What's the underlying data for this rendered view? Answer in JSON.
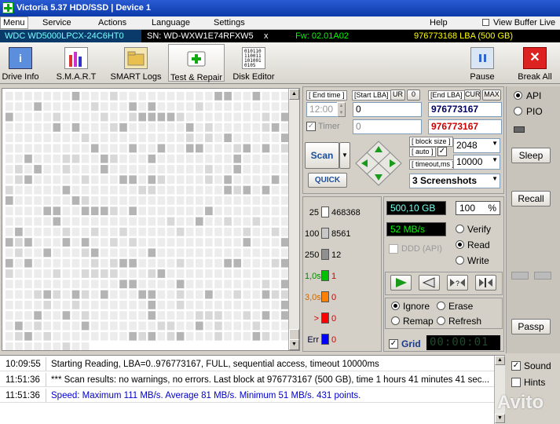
{
  "window": {
    "title": "Victoria 5.37 HDD/SSD | Device 1"
  },
  "menu": {
    "items": [
      "Menu",
      "Service",
      "Actions",
      "Language",
      "Settings",
      "Help"
    ],
    "view_buffer": "View Buffer Live"
  },
  "device": {
    "model": "WDC WD5000LPCX-24C6HT0",
    "serial": "SN: WD-WXW1E74RFXW5",
    "close": "x",
    "firmware": "Fw: 02.01A02",
    "lba": "976773168 LBA (500 GB)"
  },
  "toolbar": {
    "drive_info": "Drive Info",
    "smart": "S.M.A.R.T",
    "smart_logs": "SMART Logs",
    "test_repair": "Test & Repair",
    "disk_editor": "Disk Editor",
    "pause": "Pause",
    "break_all": "Break All"
  },
  "scan": {
    "end_time_lbl": "[ End time ]",
    "start_lba_lbl": "[Start LBA]",
    "ur": "UR",
    "zero": "0",
    "end_lba_lbl": "[End LBA]",
    "cur": "CUR",
    "max": "MAX",
    "time_value": "12:00",
    "start_lba": "0",
    "end_lba": "976773167",
    "timer_label": "Timer",
    "timer_value": "0",
    "end_lba2": "976773167",
    "block_size_lbl": "[ block size ]",
    "auto_lbl": "[ auto ]",
    "block_size": "2048",
    "timeout_lbl": "[ timeout,ms ]",
    "timeout": "10000",
    "scan_btn": "Scan",
    "quick_btn": "QUICK",
    "screenshots": "3 Screenshots"
  },
  "legend": [
    {
      "label": "25",
      "count": "468368",
      "color": "#ffffff"
    },
    {
      "label": "100",
      "count": "8561",
      "color": "#c8c8c8"
    },
    {
      "label": "250",
      "count": "12",
      "color": "#909090"
    },
    {
      "label": "1,0s",
      "count": "1",
      "color": "#00c000"
    },
    {
      "label": "3,0s",
      "count": "0",
      "color": "#ff8000"
    },
    {
      "label": ">",
      "count": "0",
      "color": "#ff0000"
    },
    {
      "label": "Err",
      "count": "0",
      "color": "#0000ff"
    }
  ],
  "stats": {
    "size": "500,10 GB",
    "percent": "100",
    "pct_sign": "%",
    "speed": "52 MB/s"
  },
  "mode": {
    "verify": "Verify",
    "read": "Read",
    "write": "Write",
    "ddd": "DDD (API)",
    "ignore": "Ignore",
    "erase": "Erase",
    "remap": "Remap",
    "refresh": "Refresh",
    "grid": "Grid",
    "timer": "00:00:01"
  },
  "side": {
    "api": "API",
    "pio": "PIO",
    "sleep": "Sleep",
    "recall": "Recall",
    "passp": "Passp"
  },
  "log": [
    {
      "time": "10:09:55",
      "msg": "Starting Reading, LBA=0..976773167, FULL, sequential access, timeout 10000ms",
      "color": "#000000"
    },
    {
      "time": "11:51:36",
      "msg": "*** Scan results: no warnings, no errors. Last block at 976773167 (500 GB), time 1 hours 41 minutes 41 sec...",
      "color": "#000000"
    },
    {
      "time": "11:51:36",
      "msg": "Speed: Maximum 111 MB/s. Average 81 MB/s. Minimum 51 MB/s. 431 points.",
      "color": "#0000cc"
    }
  ],
  "options": {
    "sound": "Sound",
    "hints": "Hints"
  },
  "watermark": "Avito"
}
